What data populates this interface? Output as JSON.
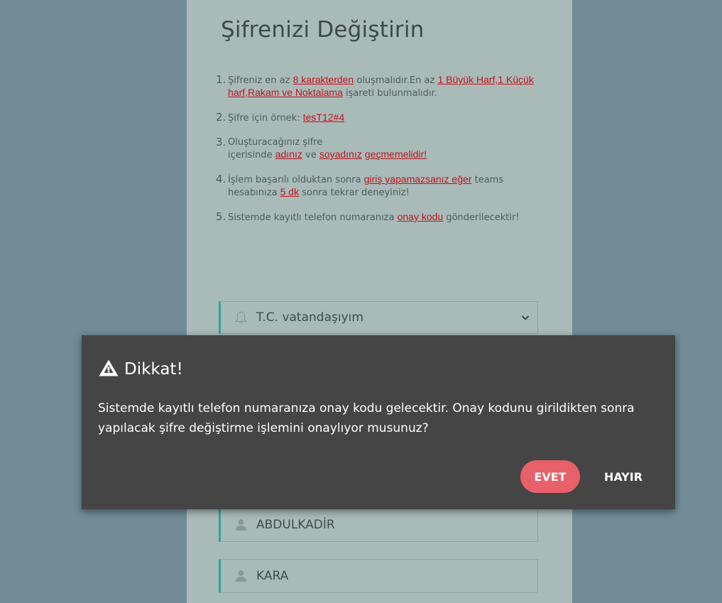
{
  "page": {
    "title": "Şifrenizi Değiştirin"
  },
  "rules": [
    {
      "num": "1.",
      "parts": [
        {
          "t": "Şifreniz en az "
        },
        {
          "t": "8 karakterden",
          "hl": true
        },
        {
          "t": " oluşmalıdır.En az "
        },
        {
          "t": "1 Büyük Harf,1 Küçük harf,Rakam ve Noktalama",
          "hl": true
        },
        {
          "t": " işareti bulunmalıdır."
        }
      ]
    },
    {
      "num": "2.",
      "parts": [
        {
          "t": "Şifre için örnek: "
        },
        {
          "t": "tesT12#4",
          "hl": true
        }
      ]
    },
    {
      "num": "3.",
      "parts": [
        {
          "t": "Oluşturacağınız şifre"
        },
        {
          "br": true
        },
        {
          "t": "içerisinde "
        },
        {
          "t": "adınız",
          "hl": true
        },
        {
          "t": " ve "
        },
        {
          "t": "soyadınız",
          "hl": true
        },
        {
          "t": " "
        },
        {
          "t": "geçmemelidir!",
          "hl": true
        }
      ]
    },
    {
      "num": "4.",
      "parts": [
        {
          "t": "İşlem başarılı olduktan sonra "
        },
        {
          "t": "giriş yapamazsanız eğer",
          "hl": true
        },
        {
          "t": " teams hesabınıza "
        },
        {
          "t": "5 dk",
          "hl": true
        },
        {
          "t": " sonra tekrar deneyiniz!"
        }
      ]
    },
    {
      "num": "5.",
      "parts": [
        {
          "t": "Sistemde kayıtlı telefon numaranıza "
        },
        {
          "t": "onay kodu",
          "hl": true
        },
        {
          "t": " gönderilecektir!"
        }
      ]
    }
  ],
  "form": {
    "citizenship_value": "T.C. vatandaşıyım",
    "first_name": "ABDULKADİR",
    "last_name": "KARA"
  },
  "dialog": {
    "title": "Dikkat!",
    "message": "Sistemde kayıtlı telefon numaranıza onay kodu gelecektir. Onay kodunu girildikten sonra yapılacak şifre değiştirme işlemini onaylıyor musunuz?",
    "confirm_label": "EVET",
    "cancel_label": "HAYIR"
  },
  "icons": {
    "citizenship": "bell-icon",
    "name": "user-icon",
    "dialog": "warning-icon",
    "select": "chevron-down-icon"
  },
  "colors": {
    "highlight": "#c0141e",
    "confirm_button": "#e8606a",
    "dialog_bg": "#454545",
    "field_accent": "#2ea59a"
  }
}
